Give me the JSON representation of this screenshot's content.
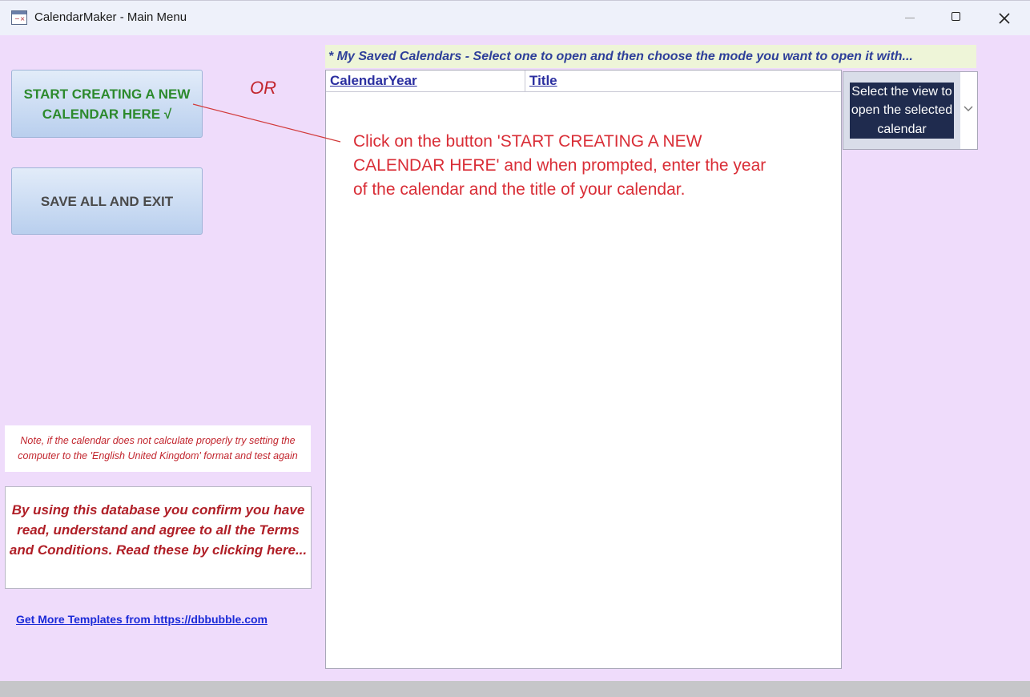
{
  "window": {
    "title": "CalendarMaker - Main Menu",
    "app_icon": "access-form-icon",
    "controls": [
      "minimize-icon",
      "maximize-icon",
      "close-icon"
    ]
  },
  "buttons": {
    "start_label": "START CREATING A NEW CALENDAR HERE √",
    "exit_label": "SAVE ALL AND EXIT"
  },
  "or_label": "OR",
  "saved_calendars": {
    "header": "* My Saved Calendars - Select one to open and then choose the mode you want to open it with...",
    "columns": [
      "CalendarYear",
      "Title"
    ],
    "rows": []
  },
  "instructions": "Click on the button 'START CREATING A NEW CALENDAR HERE' and when prompted, enter the year of the calendar and the title of your calendar.",
  "view_select": {
    "placeholder": "Select the view to open the selected calendar"
  },
  "note": "Note, if the calendar does not calculate properly try setting the computer to the 'English United Kingdom' format and test again",
  "terms": "By using this database you confirm you have read, understand and agree to all the Terms and Conditions. Read these by clicking here...",
  "templates_link": "Get More Templates from https://dbbubble.com",
  "colors": {
    "form_background": "#efdcfb",
    "start_text": "#2d8a2d",
    "instruction_text": "#d92d36",
    "header_text": "#2e3f9a",
    "link": "#1a2ad8"
  }
}
